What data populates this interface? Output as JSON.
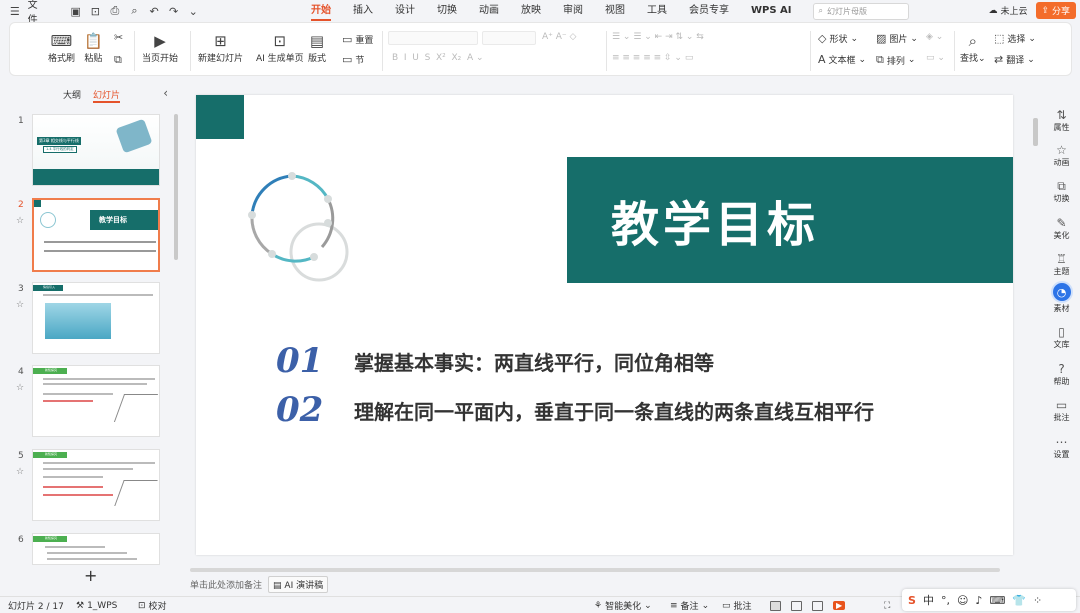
{
  "menubar": {
    "file_label": "文件",
    "tabs": [
      "开始",
      "插入",
      "设计",
      "切换",
      "动画",
      "放映",
      "审阅",
      "视图",
      "工具",
      "会员专享",
      "WPS AI"
    ],
    "active_tab": "开始",
    "search_placeholder": "幻灯片母版",
    "cloud_label": "未上云",
    "share_label": "分享"
  },
  "ribbon": {
    "format_painter": "格式刷",
    "paste": "粘贴",
    "from_current": "当页开始",
    "new_slide": "新建幻灯片",
    "ai_generate": "AI 生成单页",
    "layout": "版式",
    "reset": "重置",
    "section": "节",
    "shape": "形状",
    "picture": "图片",
    "textbox": "文本框",
    "arrange": "排列",
    "find": "查找",
    "select": "选择",
    "translate": "翻译"
  },
  "panel": {
    "tab_outline": "大纲",
    "tab_slides": "幻灯片",
    "active": "幻灯片",
    "slides": [
      {
        "num": "1",
        "title": "第3章 相交线与平行线",
        "subtitle": "1.4 平行线的判定"
      },
      {
        "num": "2",
        "title": "教学目标"
      },
      {
        "num": "3",
        "title": "情境引入"
      },
      {
        "num": "4",
        "title": "新知探究"
      },
      {
        "num": "5",
        "title": "新知探究"
      },
      {
        "num": "6",
        "title": "新知探究"
      }
    ]
  },
  "slide": {
    "title": "教学目标",
    "objectives": [
      {
        "num": "01",
        "text": "掌握基本事实：两直线平行，同位角相等"
      },
      {
        "num": "02",
        "text": "理解在同一平面内，垂直于同一条直线的两条直线互相平行"
      }
    ]
  },
  "notes_placeholder": "单击此处添加备注",
  "ai_notes": "AI 演讲稿",
  "rightbar": [
    "属性",
    "动画",
    "切换",
    "美化",
    "主题",
    "素材",
    "文库",
    "帮助",
    "批注",
    "设置"
  ],
  "statusbar": {
    "slide_info": "幻灯片 2 / 17",
    "theme": "1_WPS",
    "proof": "校对",
    "smart_beautify": "智能美化",
    "notes": "备注",
    "comments": "批注"
  },
  "ime": {
    "lang": "中"
  },
  "colors": {
    "accent": "#e5532b",
    "teal": "#166e6a",
    "number_blue": "#3c60a8"
  }
}
